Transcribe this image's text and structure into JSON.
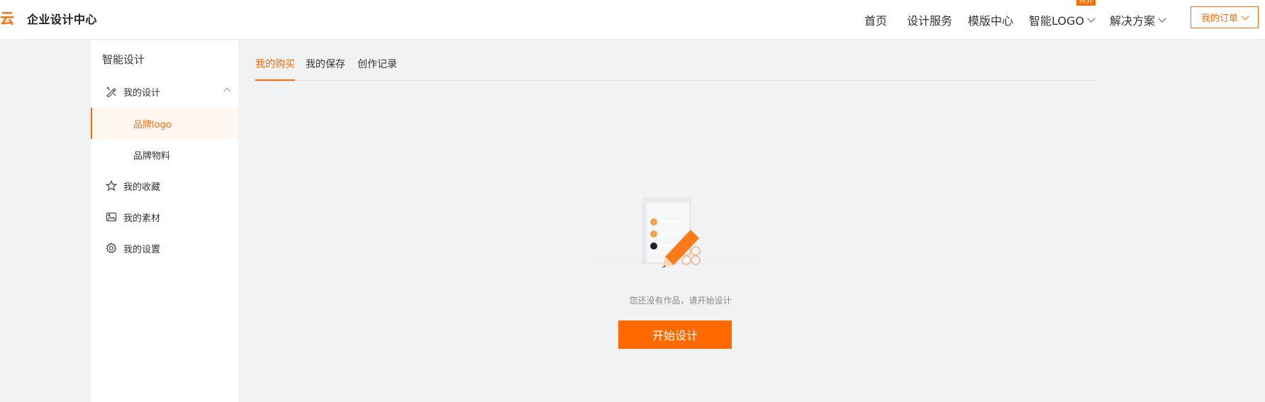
{
  "header": {
    "logo_mark": "云",
    "brand": "企业设计中心",
    "nav": [
      {
        "label": "首页"
      },
      {
        "label": "设计服务"
      },
      {
        "label": "模版中心"
      },
      {
        "label": "智能LOGO",
        "dropdown": true,
        "badge": "HOT"
      },
      {
        "label": "解决方案",
        "dropdown": true
      }
    ],
    "order_button": "我的订单"
  },
  "sidebar": {
    "title": "智能设计",
    "items": [
      {
        "label": "我的设计",
        "icon": "design-tools-icon",
        "expanded": true
      },
      {
        "label": "品牌logo",
        "sub": true,
        "active": true
      },
      {
        "label": "品牌物料",
        "sub": true
      },
      {
        "label": "我的收藏",
        "icon": "star-icon"
      },
      {
        "label": "我的素材",
        "icon": "image-icon"
      },
      {
        "label": "我的设置",
        "icon": "gear-icon"
      }
    ]
  },
  "tabs": [
    {
      "label": "我的购买",
      "active": true
    },
    {
      "label": "我的保存"
    },
    {
      "label": "创作记录"
    }
  ],
  "empty_state": {
    "message": "您还没有作品，请开始设计",
    "button": "开始设计"
  },
  "colors": {
    "accent": "#ff6a00",
    "background": "#f1f2f4"
  }
}
